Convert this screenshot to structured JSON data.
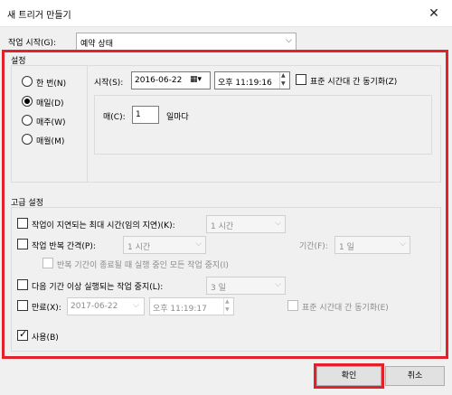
{
  "window": {
    "title": "새 트리거 만들기",
    "close_glyph": "✕"
  },
  "begin_task": {
    "label": "작업 시작(G):",
    "value": "예약 상태"
  },
  "settings": {
    "title": "설정",
    "radios": [
      {
        "label": "한 번(N)",
        "selected": false
      },
      {
        "label": "매일(D)",
        "selected": true
      },
      {
        "label": "매주(W)",
        "selected": false
      },
      {
        "label": "매월(M)",
        "selected": false
      }
    ],
    "start_label": "시작(S):",
    "start_date": "2016-06-22",
    "start_time": "오후 11:19:16",
    "sync_label": "표준 시간대 간 동기화(Z)",
    "recur_label": "매(C):",
    "recur_value": "1",
    "recur_unit": "일마다"
  },
  "advanced": {
    "title": "고급 설정",
    "delay_label": "작업이 지연되는 최대 시간(임의 지연)(K):",
    "delay_value": "1 시간",
    "repeat_label": "작업 반복 간격(P):",
    "repeat_value": "1 시간",
    "duration_label": "기간(F):",
    "duration_value": "1 일",
    "stop_all_label": "반복 기간이 종료될 때 실행 중인 모든 작업 중지(I)",
    "stop_label": "다음 기간 이상 실행되는 작업 중지(L):",
    "stop_value": "3 일",
    "expire_label": "만료(X):",
    "expire_date": "2017-06-22",
    "expire_time": "오후 11:19:17",
    "expire_sync_label": "표준 시간대 간 동기화(E)",
    "enabled_label": "사용(B)",
    "enabled_checked": true
  },
  "buttons": {
    "ok": "확인",
    "cancel": "취소"
  },
  "colors": {
    "highlight": "#e3212b"
  }
}
